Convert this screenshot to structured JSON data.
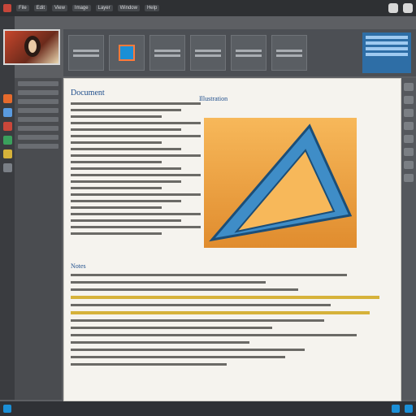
{
  "topbar": {
    "items": [
      "File",
      "Edit",
      "View",
      "Image",
      "Layer",
      "Window",
      "Help"
    ]
  },
  "doc": {
    "title": "Document",
    "figure_title": "Illustration",
    "section_title": "Notes"
  },
  "taskbar": {
    "start_label": "",
    "page_indicator": ""
  },
  "colors": {
    "accent": "#1b8fd6",
    "highlight": "#d6b23a",
    "figure_bg": "#f7b85a"
  },
  "icons": [
    "search-icon",
    "gear-icon",
    "folder-icon",
    "image-icon"
  ]
}
